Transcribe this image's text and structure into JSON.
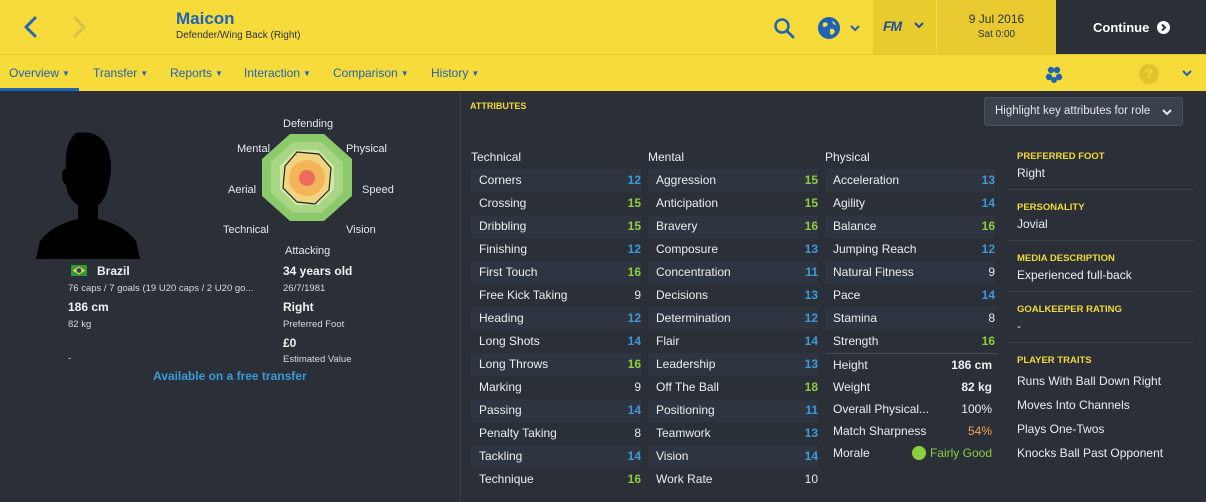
{
  "header": {
    "player_name": "Maicon",
    "position": "Defender/Wing Back (Right)",
    "date": "9 Jul 2016",
    "day_time": "Sat 0:00",
    "continue_label": "Continue",
    "fm_label": "FM",
    "colors": {
      "bar": "#f6db3a",
      "accent": "#1f63b4"
    }
  },
  "tabs": [
    {
      "label": "Overview"
    },
    {
      "label": "Transfer"
    },
    {
      "label": "Reports"
    },
    {
      "label": "Interaction"
    },
    {
      "label": "Comparison"
    },
    {
      "label": "History"
    }
  ],
  "radar": {
    "labels": {
      "defending": "Defending",
      "physical": "Physical",
      "speed": "Speed",
      "vision": "Vision",
      "attacking": "Attacking",
      "technical": "Technical",
      "aerial": "Aerial",
      "mental": "Mental"
    }
  },
  "profile": {
    "nation": "Brazil",
    "caps": "76 caps / 7 goals (19 U20 caps / 2 U20 go...",
    "height": "186 cm",
    "weight": "82 kg",
    "placeholder": "-",
    "age": "34 years old",
    "dob": "26/7/1981",
    "foot": "Right",
    "foot_label": "Preferred Foot",
    "value": "£0",
    "value_label": "Estimated Value",
    "transfer_status": "Available on a free transfer"
  },
  "attributes": {
    "heading": "ATTRIBUTES",
    "highlight_button": "Highlight key attributes for role",
    "technical_title": "Technical",
    "mental_title": "Mental",
    "physical_title": "Physical",
    "technical": [
      {
        "name": "Corners",
        "value": "12"
      },
      {
        "name": "Crossing",
        "value": "15"
      },
      {
        "name": "Dribbling",
        "value": "15"
      },
      {
        "name": "Finishing",
        "value": "12"
      },
      {
        "name": "First Touch",
        "value": "16"
      },
      {
        "name": "Free Kick Taking",
        "value": "9"
      },
      {
        "name": "Heading",
        "value": "12"
      },
      {
        "name": "Long Shots",
        "value": "14"
      },
      {
        "name": "Long Throws",
        "value": "16"
      },
      {
        "name": "Marking",
        "value": "9"
      },
      {
        "name": "Passing",
        "value": "14"
      },
      {
        "name": "Penalty Taking",
        "value": "8"
      },
      {
        "name": "Tackling",
        "value": "14"
      },
      {
        "name": "Technique",
        "value": "16"
      }
    ],
    "mental": [
      {
        "name": "Aggression",
        "value": "15"
      },
      {
        "name": "Anticipation",
        "value": "15"
      },
      {
        "name": "Bravery",
        "value": "16"
      },
      {
        "name": "Composure",
        "value": "13"
      },
      {
        "name": "Concentration",
        "value": "11"
      },
      {
        "name": "Decisions",
        "value": "13"
      },
      {
        "name": "Determination",
        "value": "12"
      },
      {
        "name": "Flair",
        "value": "14"
      },
      {
        "name": "Leadership",
        "value": "13"
      },
      {
        "name": "Off The Ball",
        "value": "18"
      },
      {
        "name": "Positioning",
        "value": "11"
      },
      {
        "name": "Teamwork",
        "value": "13"
      },
      {
        "name": "Vision",
        "value": "14"
      },
      {
        "name": "Work Rate",
        "value": "10"
      }
    ],
    "physical": [
      {
        "name": "Acceleration",
        "value": "13"
      },
      {
        "name": "Agility",
        "value": "14"
      },
      {
        "name": "Balance",
        "value": "16"
      },
      {
        "name": "Jumping Reach",
        "value": "12"
      },
      {
        "name": "Natural Fitness",
        "value": "9"
      },
      {
        "name": "Pace",
        "value": "14"
      },
      {
        "name": "Stamina",
        "value": "8"
      },
      {
        "name": "Strength",
        "value": "16"
      }
    ],
    "physical_extra": [
      {
        "name": "Height",
        "value": "186 cm"
      },
      {
        "name": "Weight",
        "value": "82 kg"
      },
      {
        "name": "Overall Physical...",
        "value": "100%"
      },
      {
        "name": "Match Sharpness",
        "value": "54%"
      },
      {
        "name": "Morale",
        "value": "Fairly Good"
      }
    ]
  },
  "side": {
    "preferred_foot_label": "PREFERRED FOOT",
    "preferred_foot": "Right",
    "personality_label": "PERSONALITY",
    "personality": "Jovial",
    "media_label": "MEDIA DESCRIPTION",
    "media": "Experienced full-back",
    "gk_label": "GOALKEEPER RATING",
    "gk": "-",
    "traits_label": "PLAYER TRAITS",
    "traits": [
      "Runs With Ball Down Right",
      "Moves Into Channels",
      "Plays One-Twos",
      "Knocks Ball Past Opponent"
    ]
  },
  "value_colors": {
    "low": "#e6e8ea",
    "mid": "#3d9ad8",
    "high": "#8ccf3c"
  }
}
